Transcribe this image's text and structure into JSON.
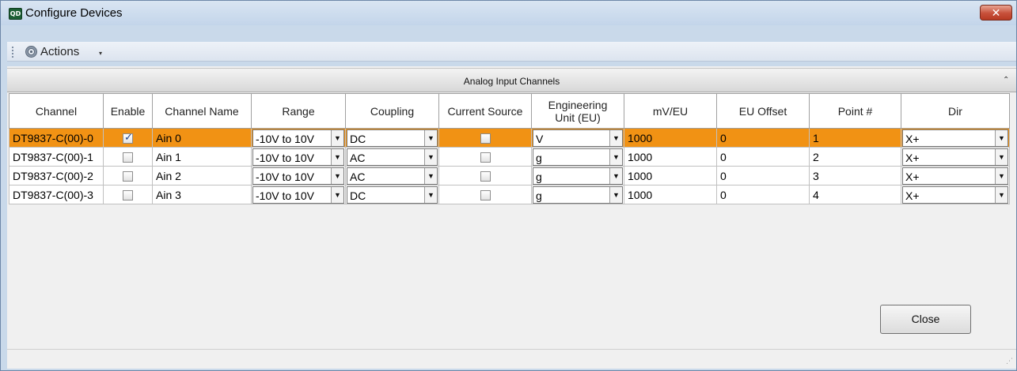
{
  "window": {
    "title": "Configure Devices",
    "app_icon_text": "QD",
    "close_glyph": "✕"
  },
  "toolbar": {
    "actions_label": "Actions",
    "actions_caret": "▾",
    "gear_icon": "gear-icon"
  },
  "group": {
    "title": "Analog Input Channels",
    "collapse_glyph": "⌃"
  },
  "table": {
    "headers": {
      "channel": "Channel",
      "enable": "Enable",
      "channel_name": "Channel Name",
      "range": "Range",
      "coupling": "Coupling",
      "current_source": "Current Source",
      "eu_line1": "Engineering",
      "eu_line2": "Unit (EU)",
      "mv_eu": "mV/EU",
      "eu_offset": "EU Offset",
      "point": "Point #",
      "dir": "Dir"
    },
    "rows": [
      {
        "channel": "DT9837-C(00)-0",
        "enable": true,
        "name": "Ain 0",
        "range": "-10V to 10V",
        "coupling": "DC",
        "current_source": false,
        "eu": "V",
        "mv_eu": "1000",
        "eu_offset": "0",
        "point": "1",
        "dir": "X+"
      },
      {
        "channel": "DT9837-C(00)-1",
        "enable": false,
        "name": "Ain 1",
        "range": "-10V to 10V",
        "coupling": "AC",
        "current_source": false,
        "eu": "g",
        "mv_eu": "1000",
        "eu_offset": "0",
        "point": "2",
        "dir": "X+"
      },
      {
        "channel": "DT9837-C(00)-2",
        "enable": false,
        "name": "Ain 2",
        "range": "-10V to 10V",
        "coupling": "AC",
        "current_source": false,
        "eu": "g",
        "mv_eu": "1000",
        "eu_offset": "0",
        "point": "3",
        "dir": "X+"
      },
      {
        "channel": "DT9837-C(00)-3",
        "enable": false,
        "name": "Ain 3",
        "range": "-10V to 10V",
        "coupling": "DC",
        "current_source": false,
        "eu": "g",
        "mv_eu": "1000",
        "eu_offset": "0",
        "point": "4",
        "dir": "X+"
      }
    ],
    "selected_row": 0,
    "selected_color": "#f19214"
  },
  "buttons": {
    "close_label": "Close"
  },
  "status": {
    "grip_glyph": "⋰"
  }
}
